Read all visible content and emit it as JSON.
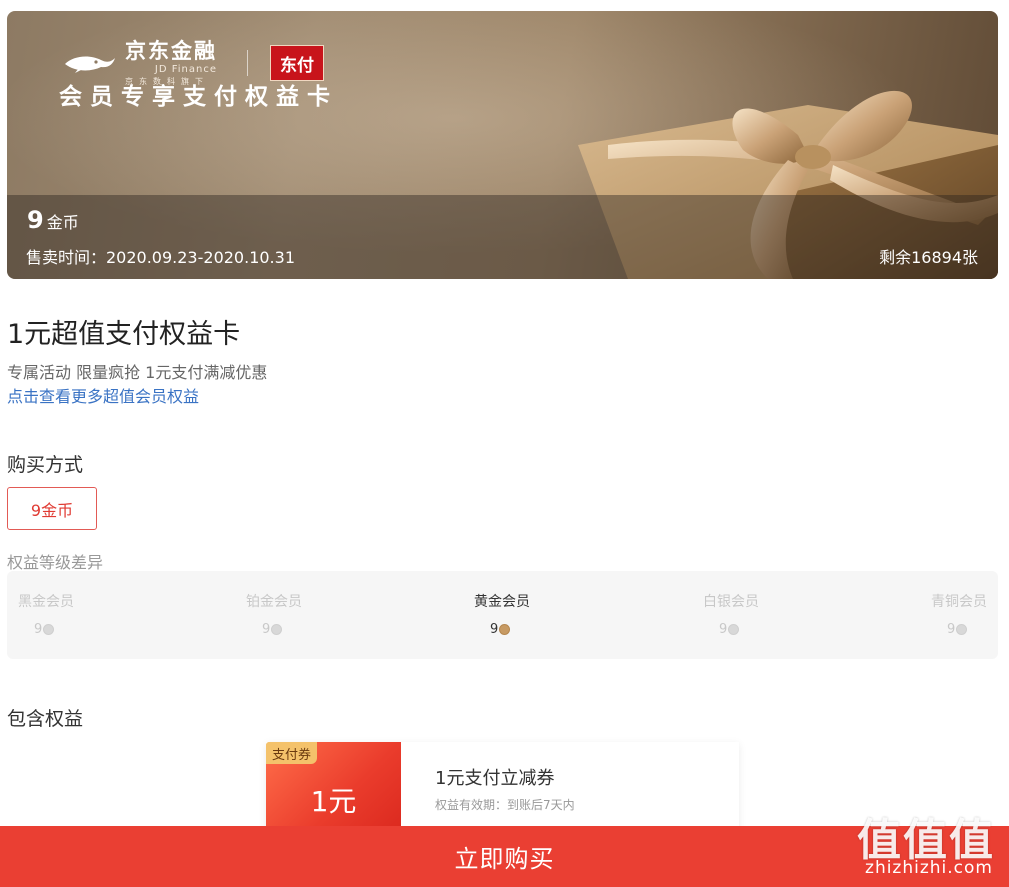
{
  "banner": {
    "brand_name": "京东金融",
    "brand_en": "JD Finance",
    "brand_slogan": "京东数科旗下",
    "partner_logo": "东付",
    "title": "会员专享支付权益卡",
    "price_value": "9",
    "price_unit": "金币",
    "sale_time": "售卖时间：2020.09.23-2020.10.31",
    "remaining": "剩余16894张"
  },
  "card": {
    "title": "1元超值支付权益卡",
    "description": "专属活动 限量疯抢 1元支付满减优惠",
    "more_link": "点击查看更多超值会员权益"
  },
  "purchase": {
    "label": "购买方式",
    "option": "9金币"
  },
  "levels": {
    "label": "权益等级差异",
    "items": [
      {
        "name": "黑金会员",
        "price": "9",
        "active": false
      },
      {
        "name": "铂金会员",
        "price": "9",
        "active": false
      },
      {
        "name": "黄金会员",
        "price": "9",
        "active": true
      },
      {
        "name": "白银会员",
        "price": "9",
        "active": false
      },
      {
        "name": "青铜会员",
        "price": "9",
        "active": false
      }
    ]
  },
  "benefits": {
    "label": "包含权益",
    "items": [
      {
        "tag": "支付券",
        "amount": "1元",
        "name": "1元支付立减券",
        "validity": "权益有效期：到账后7天内"
      }
    ]
  },
  "buy_button": "立即购买",
  "watermark": {
    "glyphs": "值值值",
    "url": "zhizhizhi.com"
  },
  "colors": {
    "accent": "#ea3f33",
    "link": "#3a73c4",
    "gold": "#c79a63"
  },
  "icons": {
    "brand": "jd-fish-icon",
    "coin": "coin-icon",
    "gift": "gift-box-icon"
  }
}
